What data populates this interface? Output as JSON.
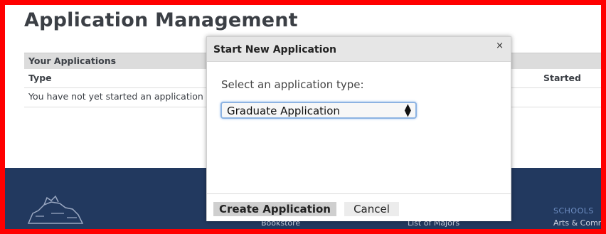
{
  "page": {
    "title": "Application Management",
    "table_header": "Your Applications",
    "columns": {
      "type": "Type",
      "started": "Started"
    },
    "empty_message": "You have not yet started an application"
  },
  "footer": {
    "link_bookstore": "Bookstore",
    "link_majors": "List of Majors",
    "schools_heading": "SCHOOLS",
    "schools_item": "Arts & Comm"
  },
  "modal": {
    "title": "Start New Application",
    "close_glyph": "×",
    "prompt": "Select an application type:",
    "selected_type": "Graduate Application",
    "create_label": "Create Application",
    "cancel_label": "Cancel"
  },
  "icons": {
    "select_arrows": "updown-arrows-icon",
    "close": "close-icon",
    "logo": "lion-crest-logo"
  },
  "colors": {
    "border": "#ff0000",
    "footer_bg": "#22395f",
    "focus": "#8db3e2"
  }
}
